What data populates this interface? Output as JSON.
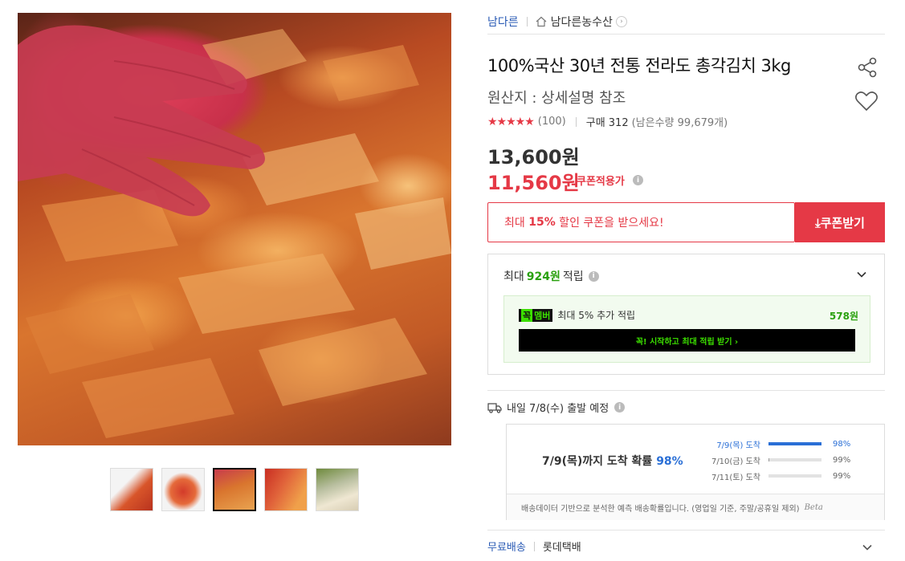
{
  "brand": {
    "name": "남다른",
    "store_name": "남다른농수산",
    "store_arrow": "›"
  },
  "product": {
    "title": "100%국산 30년 전통 전라도 총각김치 3kg",
    "origin": "원산지 : 상세설명 참조",
    "stars": "★★★★★",
    "rating": 4.5,
    "review_count": "(100)",
    "purchase": "구매 312",
    "remaining": "(남은수량 99,679개)"
  },
  "price": {
    "original": "13,600원",
    "sale": "11,560원",
    "coupon_label": "쿠폰적용가"
  },
  "coupon": {
    "text_prefix": "최대 ",
    "text_percent": "15%",
    "text_suffix": " 할인 쿠폰을 받으세요!",
    "button_label": "⤓쿠폰받기"
  },
  "points": {
    "prefix": "최대",
    "amount": "924원",
    "suffix": "적립",
    "member_badge_a": "꼭",
    "member_badge_b": "멤버",
    "member_text": "최대 5% 추가 적립",
    "member_amount": "578원",
    "member_button": "꼭! 시작하고 최대 적립 받기 ›"
  },
  "shipping": {
    "departure": "내일 7/8(수) 출발 예정",
    "arrival_main": "7/9(목)까지 도착 확률",
    "arrival_pct": "98%",
    "probabilities": [
      {
        "label": "7/9(목) 도착",
        "pct": "98%",
        "fill": 1.0
      },
      {
        "label": "7/10(금) 도착",
        "pct": "99%",
        "fill": 0.02
      },
      {
        "label": "7/11(토) 도착",
        "pct": "99%",
        "fill": 0.0
      }
    ],
    "footnote": "배송데이터 기반으로 분석한 예측 배송확률입니다. (영업일 기준, 주말/공휴일 제외)",
    "beta": "Beta"
  },
  "delivery": {
    "free_label": "무료배송",
    "carrier": "롯데택배"
  },
  "colors": {
    "accent_red": "#e53946",
    "link_blue": "#2a5bb5",
    "point_green": "#2aa10f",
    "member_green": "#3ce000",
    "prob_blue": "#2a6fd6"
  },
  "icons": [
    "home-icon",
    "share-icon",
    "heart-icon",
    "info-icon",
    "download-icon",
    "chevron-down-icon",
    "truck-icon"
  ]
}
